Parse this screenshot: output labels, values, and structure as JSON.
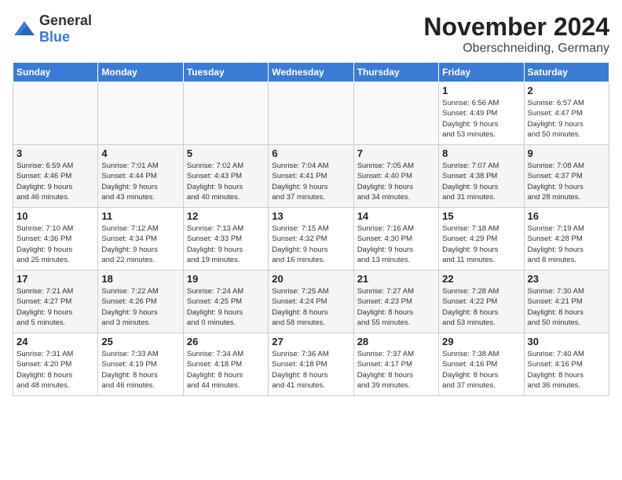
{
  "logo": {
    "general": "General",
    "blue": "Blue"
  },
  "header": {
    "month": "November 2024",
    "location": "Oberschneiding, Germany"
  },
  "weekdays": [
    "Sunday",
    "Monday",
    "Tuesday",
    "Wednesday",
    "Thursday",
    "Friday",
    "Saturday"
  ],
  "weeks": [
    [
      {
        "day": "",
        "info": "",
        "empty": true
      },
      {
        "day": "",
        "info": "",
        "empty": true
      },
      {
        "day": "",
        "info": "",
        "empty": true
      },
      {
        "day": "",
        "info": "",
        "empty": true
      },
      {
        "day": "",
        "info": "",
        "empty": true
      },
      {
        "day": "1",
        "info": "Sunrise: 6:56 AM\nSunset: 4:49 PM\nDaylight: 9 hours\nand 53 minutes."
      },
      {
        "day": "2",
        "info": "Sunrise: 6:57 AM\nSunset: 4:47 PM\nDaylight: 9 hours\nand 50 minutes."
      }
    ],
    [
      {
        "day": "3",
        "info": "Sunrise: 6:59 AM\nSunset: 4:46 PM\nDaylight: 9 hours\nand 46 minutes."
      },
      {
        "day": "4",
        "info": "Sunrise: 7:01 AM\nSunset: 4:44 PM\nDaylight: 9 hours\nand 43 minutes."
      },
      {
        "day": "5",
        "info": "Sunrise: 7:02 AM\nSunset: 4:43 PM\nDaylight: 9 hours\nand 40 minutes."
      },
      {
        "day": "6",
        "info": "Sunrise: 7:04 AM\nSunset: 4:41 PM\nDaylight: 9 hours\nand 37 minutes."
      },
      {
        "day": "7",
        "info": "Sunrise: 7:05 AM\nSunset: 4:40 PM\nDaylight: 9 hours\nand 34 minutes."
      },
      {
        "day": "8",
        "info": "Sunrise: 7:07 AM\nSunset: 4:38 PM\nDaylight: 9 hours\nand 31 minutes."
      },
      {
        "day": "9",
        "info": "Sunrise: 7:08 AM\nSunset: 4:37 PM\nDaylight: 9 hours\nand 28 minutes."
      }
    ],
    [
      {
        "day": "10",
        "info": "Sunrise: 7:10 AM\nSunset: 4:36 PM\nDaylight: 9 hours\nand 25 minutes."
      },
      {
        "day": "11",
        "info": "Sunrise: 7:12 AM\nSunset: 4:34 PM\nDaylight: 9 hours\nand 22 minutes."
      },
      {
        "day": "12",
        "info": "Sunrise: 7:13 AM\nSunset: 4:33 PM\nDaylight: 9 hours\nand 19 minutes."
      },
      {
        "day": "13",
        "info": "Sunrise: 7:15 AM\nSunset: 4:32 PM\nDaylight: 9 hours\nand 16 minutes."
      },
      {
        "day": "14",
        "info": "Sunrise: 7:16 AM\nSunset: 4:30 PM\nDaylight: 9 hours\nand 13 minutes."
      },
      {
        "day": "15",
        "info": "Sunrise: 7:18 AM\nSunset: 4:29 PM\nDaylight: 9 hours\nand 11 minutes."
      },
      {
        "day": "16",
        "info": "Sunrise: 7:19 AM\nSunset: 4:28 PM\nDaylight: 9 hours\nand 8 minutes."
      }
    ],
    [
      {
        "day": "17",
        "info": "Sunrise: 7:21 AM\nSunset: 4:27 PM\nDaylight: 9 hours\nand 5 minutes."
      },
      {
        "day": "18",
        "info": "Sunrise: 7:22 AM\nSunset: 4:26 PM\nDaylight: 9 hours\nand 3 minutes."
      },
      {
        "day": "19",
        "info": "Sunrise: 7:24 AM\nSunset: 4:25 PM\nDaylight: 9 hours\nand 0 minutes."
      },
      {
        "day": "20",
        "info": "Sunrise: 7:25 AM\nSunset: 4:24 PM\nDaylight: 8 hours\nand 58 minutes."
      },
      {
        "day": "21",
        "info": "Sunrise: 7:27 AM\nSunset: 4:23 PM\nDaylight: 8 hours\nand 55 minutes."
      },
      {
        "day": "22",
        "info": "Sunrise: 7:28 AM\nSunset: 4:22 PM\nDaylight: 8 hours\nand 53 minutes."
      },
      {
        "day": "23",
        "info": "Sunrise: 7:30 AM\nSunset: 4:21 PM\nDaylight: 8 hours\nand 50 minutes."
      }
    ],
    [
      {
        "day": "24",
        "info": "Sunrise: 7:31 AM\nSunset: 4:20 PM\nDaylight: 8 hours\nand 48 minutes."
      },
      {
        "day": "25",
        "info": "Sunrise: 7:33 AM\nSunset: 4:19 PM\nDaylight: 8 hours\nand 46 minutes."
      },
      {
        "day": "26",
        "info": "Sunrise: 7:34 AM\nSunset: 4:18 PM\nDaylight: 8 hours\nand 44 minutes."
      },
      {
        "day": "27",
        "info": "Sunrise: 7:36 AM\nSunset: 4:18 PM\nDaylight: 8 hours\nand 41 minutes."
      },
      {
        "day": "28",
        "info": "Sunrise: 7:37 AM\nSunset: 4:17 PM\nDaylight: 8 hours\nand 39 minutes."
      },
      {
        "day": "29",
        "info": "Sunrise: 7:38 AM\nSunset: 4:16 PM\nDaylight: 8 hours\nand 37 minutes."
      },
      {
        "day": "30",
        "info": "Sunrise: 7:40 AM\nSunset: 4:16 PM\nDaylight: 8 hours\nand 36 minutes."
      }
    ]
  ]
}
